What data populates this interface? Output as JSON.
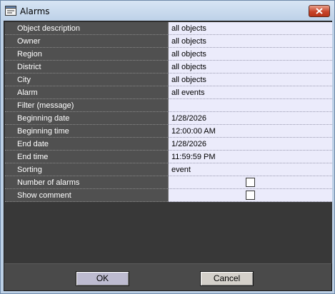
{
  "window": {
    "title": "Alarms"
  },
  "rows": [
    {
      "label": "Object description",
      "value": "all objects"
    },
    {
      "label": "Owner",
      "value": "all objects"
    },
    {
      "label": "Region",
      "value": "all objects"
    },
    {
      "label": "District",
      "value": "all objects"
    },
    {
      "label": "City",
      "value": "all objects"
    },
    {
      "label": "Alarm",
      "value": "all events"
    },
    {
      "label": "Filter (message)",
      "value": ""
    },
    {
      "label": "Beginning date",
      "value": "1/28/2026"
    },
    {
      "label": "Beginning time",
      "value": "12:00:00 AM"
    },
    {
      "label": "End date",
      "value": "1/28/2026"
    },
    {
      "label": "End time",
      "value": "11:59:59 PM"
    },
    {
      "label": "Sorting",
      "value": "event"
    },
    {
      "label": "Number of alarms",
      "checked": false
    },
    {
      "label": "Show comment",
      "checked": false
    }
  ],
  "buttons": {
    "ok": "OK",
    "cancel": "Cancel"
  },
  "icons": {
    "app": "window-app-icon",
    "close": "close-icon"
  },
  "colors": {
    "label_bg": "#505050",
    "value_bg": "#ebebfb",
    "client_bg": "#383838",
    "close_red": "#c7442a"
  }
}
